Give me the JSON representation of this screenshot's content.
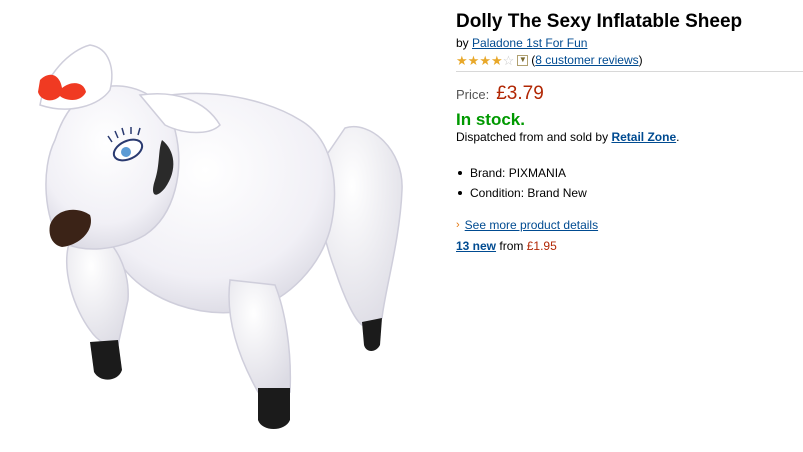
{
  "product": {
    "title": "Dolly The Sexy Inflatable Sheep",
    "by_prefix": "by",
    "brand_link": "Paladone 1st For Fun",
    "rating": {
      "stars_filled": 4,
      "stars_total": 5,
      "reviews_label": "8 customer reviews",
      "open_paren": "(",
      "close_paren": ")"
    },
    "price_label": "Price:",
    "price": "£3.79",
    "stock_status": "In stock.",
    "dispatch_prefix": "Dispatched from and sold by",
    "seller": "Retail Zone",
    "dispatch_suffix": ".",
    "bullets": [
      "Brand: PIXMANIA",
      "Condition: Brand New"
    ],
    "more_details": "See more product details",
    "offers": {
      "count_label": "13 new",
      "from_label": "from",
      "from_price": "£1.95"
    }
  },
  "colors": {
    "title": "#000000",
    "link": "#004b91",
    "price": "#b12704",
    "in_stock": "#009900",
    "star": "#e8a82a",
    "arrow": "#e47911"
  },
  "icons": {
    "star": "star-icon",
    "chevron": "chevron-down-icon",
    "arrow": "arrow-right-icon"
  }
}
